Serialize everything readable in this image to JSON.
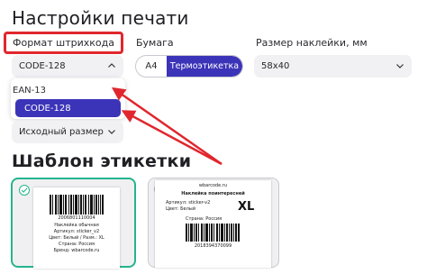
{
  "print_settings": {
    "title": "Настройки печати",
    "barcode_format": {
      "label": "Формат штрихкода",
      "selected": "CODE-128",
      "options": [
        "EAN-13",
        "CODE-128"
      ]
    },
    "paper": {
      "label": "Бумага",
      "options": [
        "A4",
        "Термоэтикетка"
      ],
      "selected": "Термоэтикетка"
    },
    "sticker_size": {
      "label": "Размер наклейки, мм",
      "selected": "58x40"
    },
    "original_size": {
      "selected": "Исходный размер"
    }
  },
  "template": {
    "title": "Шаблон этикетки",
    "card_1": {
      "selected": true,
      "barcode_number": "2006801110004",
      "lines": [
        "Наклейка обычная",
        "Артикул: sticker_v2",
        "Цвет: Белый / Разм.: XL",
        "Страна: Россия",
        "Бренд: wbarcode.ru"
      ]
    },
    "card_2": {
      "selected": false,
      "site": "wbarcode.ru",
      "name": "Наклейка поинтересней",
      "article": "Артикул: sticker-v2",
      "color": "Цвет: Белый",
      "size": "XL",
      "country": "Страна: Россия",
      "barcode_number": "2018394370099"
    }
  },
  "colors": {
    "accent": "#3c34b8",
    "highlight_frame": "#e0272d",
    "selected_card": "#25b58c",
    "arrow": "#e0272d"
  },
  "icons": [
    "chevron-up-icon",
    "chevron-down-icon",
    "check-icon",
    "arrow-icon"
  ]
}
